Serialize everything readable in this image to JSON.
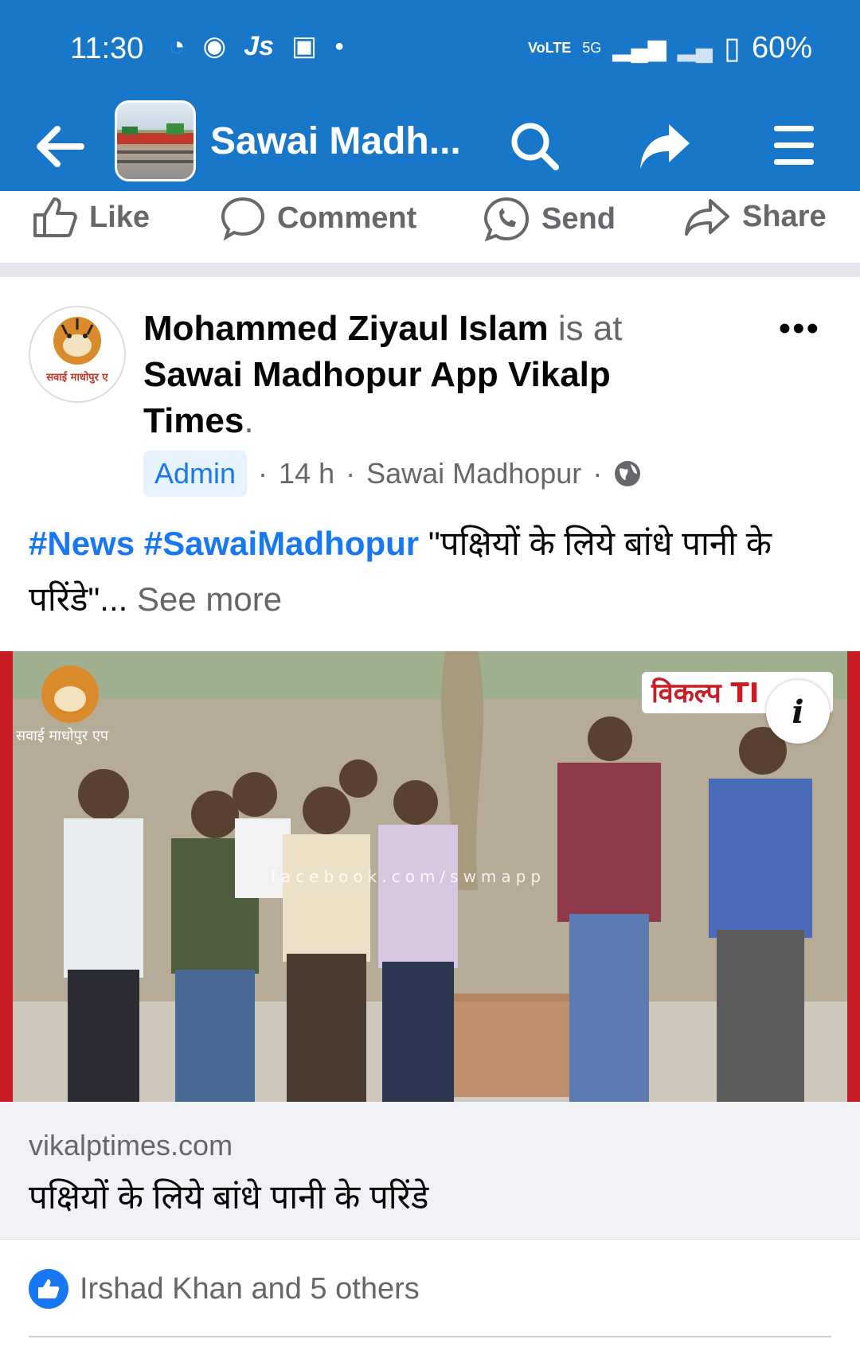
{
  "status_bar": {
    "time": "11:30",
    "network_label": "VoLTE",
    "network_type": "5G",
    "battery": "60%"
  },
  "app_bar": {
    "title": "Sawai Madh..."
  },
  "action_row": {
    "like": "Like",
    "comment": "Comment",
    "send": "Send",
    "share": "Share"
  },
  "post": {
    "author": "Mohammed Ziyaul Islam",
    "is_at": "is at",
    "location_name_1": "Sawai Madhopur App Vikalp",
    "location_name_2": "Times",
    "period": ".",
    "avatar_caption": "सवाई माधोपुर ए",
    "badge": "Admin",
    "time": "14 h",
    "place": "Sawai Madhopur",
    "sep": "·",
    "hashtags": "#News #SawaiMadhopur",
    "text_hi": "\"पक्षियों के लिये बांधे पानी के परिंडे\"...",
    "see_more": "See more",
    "more_label": "•••"
  },
  "photo": {
    "logo_text": "सवाई माधोपुर एप",
    "brand_text": "विकल्प TI",
    "watermark": "facebook.com/swmapp",
    "info_label": "i"
  },
  "link_card": {
    "domain": "vikalptimes.com",
    "title": "पक्षियों के लिये बांधे पानी के परिंडे"
  },
  "reactions": {
    "text": "Irshad Khan and 5 others"
  },
  "colors": {
    "brand": "#1877c9",
    "link": "#1877f2"
  }
}
